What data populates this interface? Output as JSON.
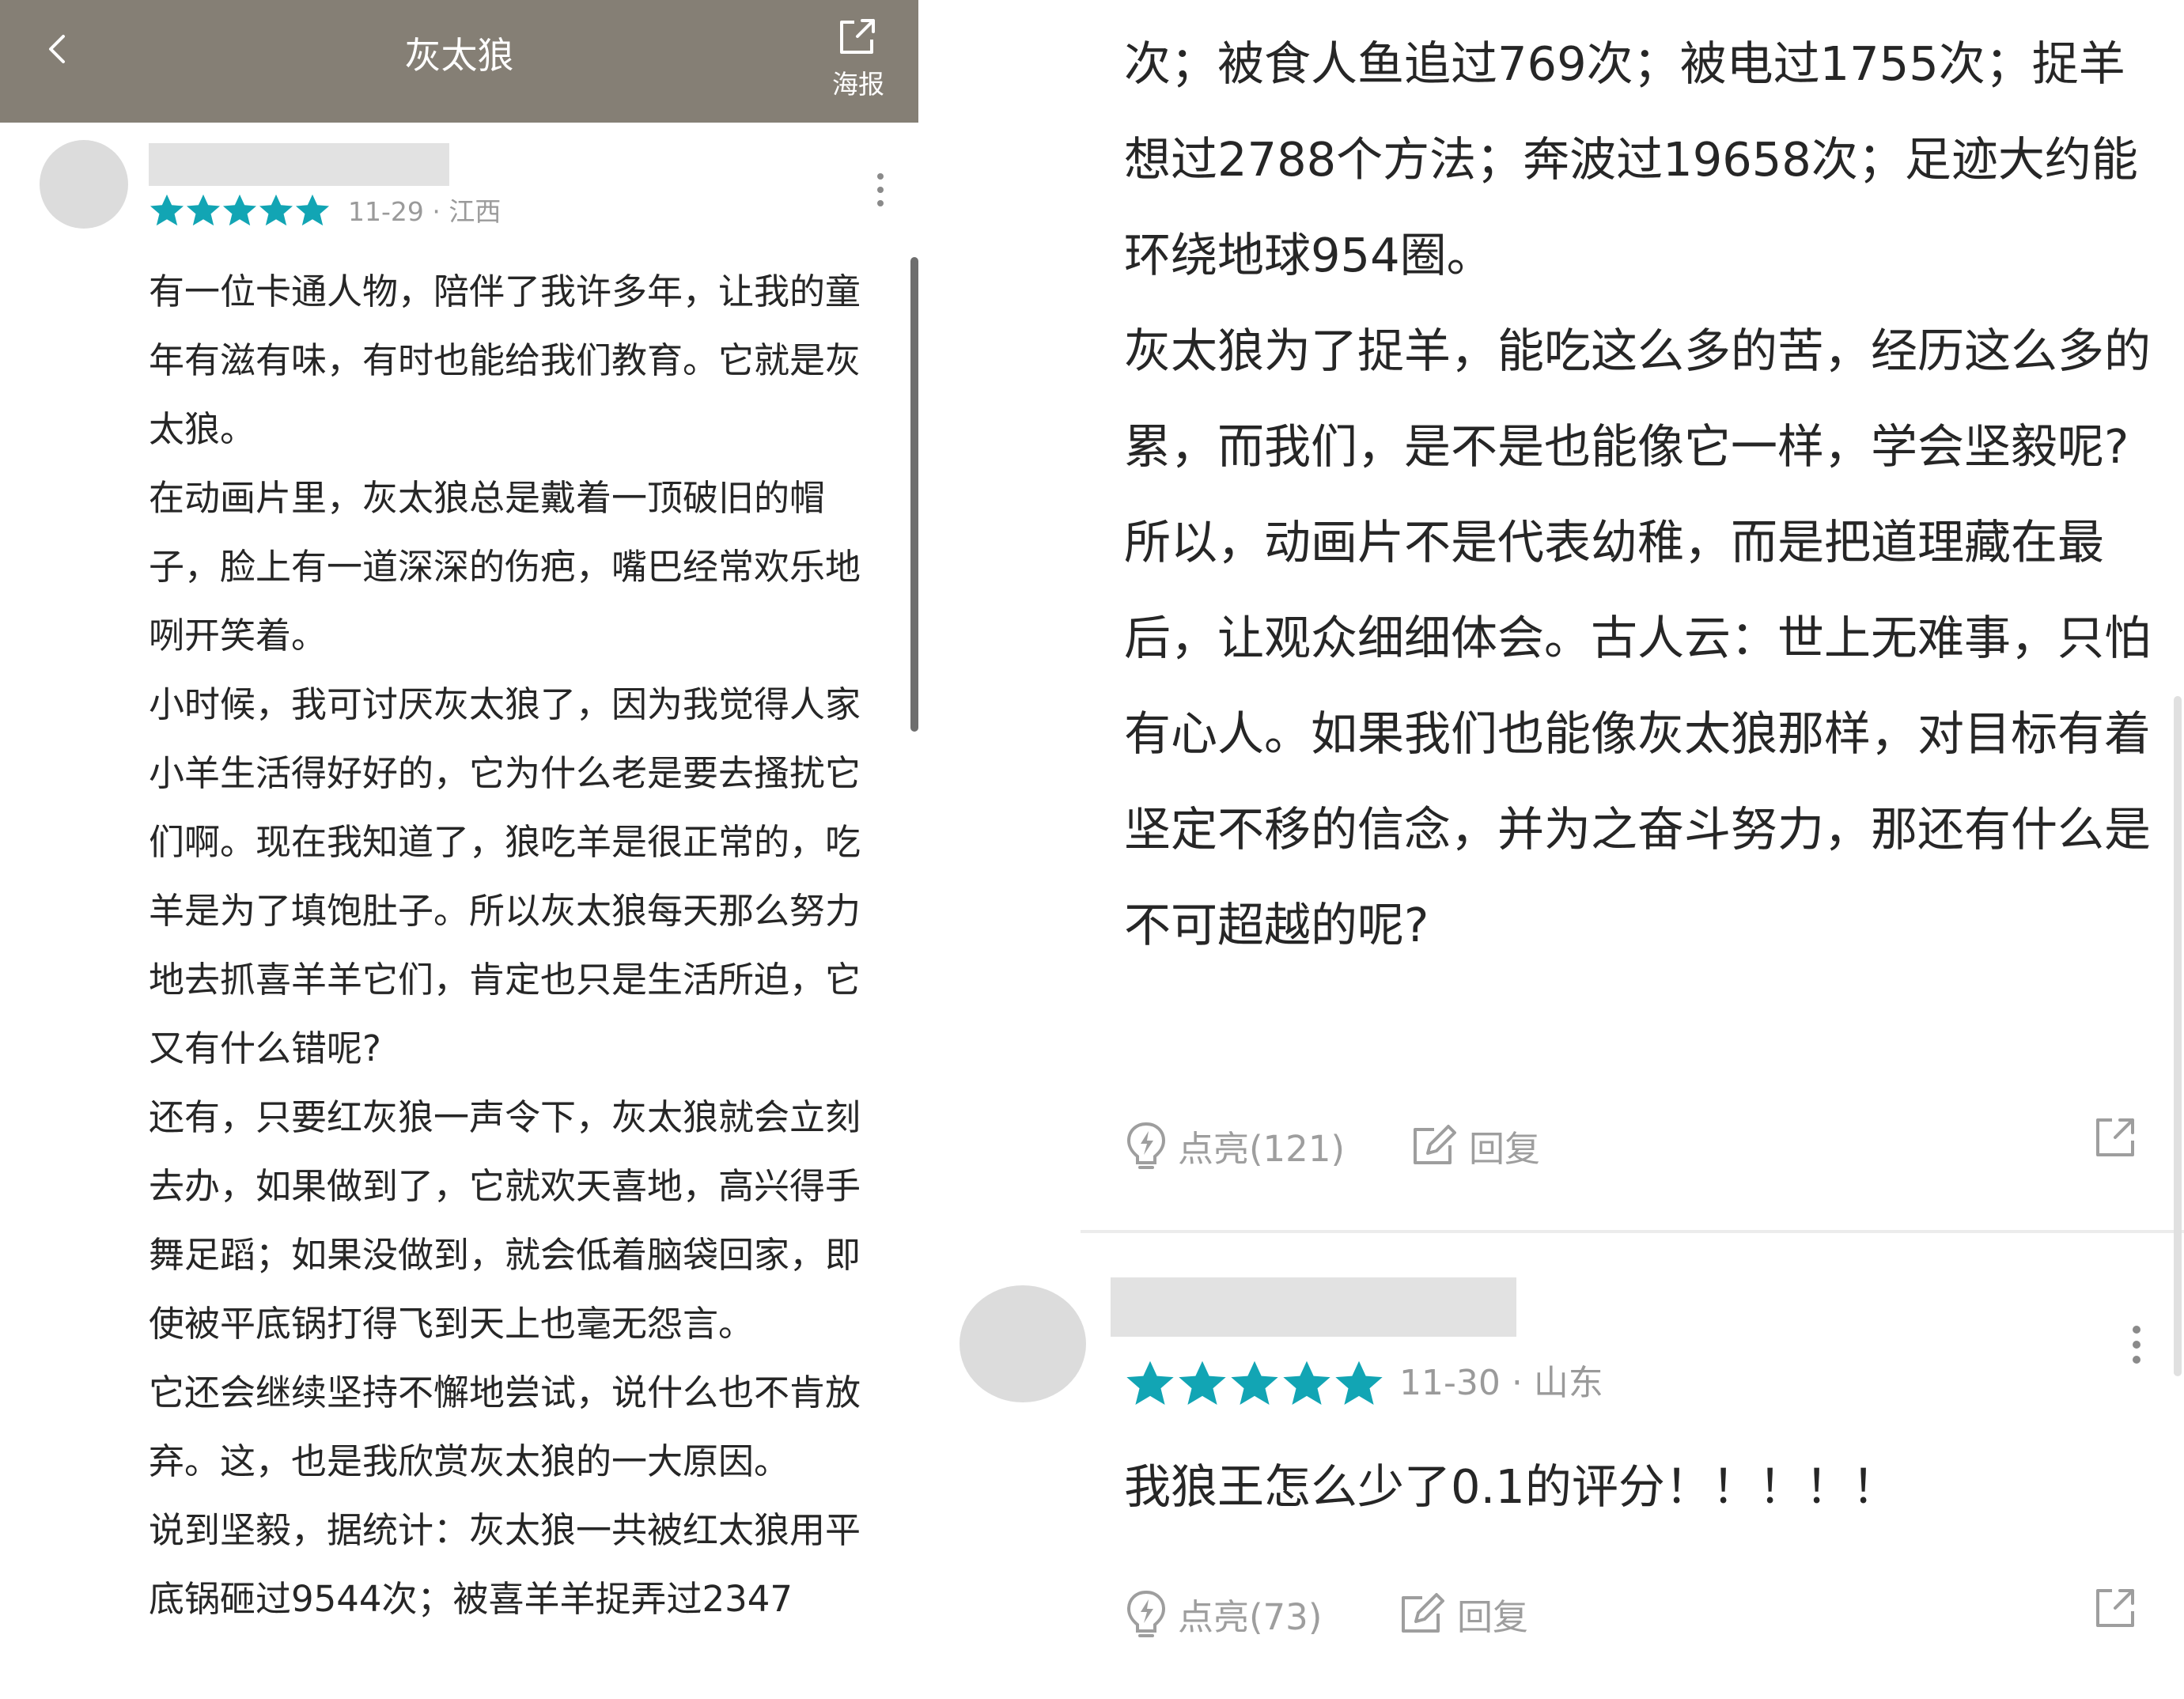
{
  "header": {
    "title": "灰太狼",
    "poster_label": "海报"
  },
  "review1": {
    "meta": "11-29 · 江西",
    "paragraphs": [
      "有一位卡通人物，陪伴了我许多年，让我的童年有滋有味，有时也能给我们教育。它就是灰太狼。",
      "在动画片里，灰太狼总是戴着一顶破旧的帽子，脸上有一道深深的伤疤，嘴巴经常欢乐地咧开笑着。",
      "小时候，我可讨厌灰太狼了，因为我觉得人家小羊生活得好好的，它为什么老是要去搔扰它们啊。现在我知道了，狼吃羊是很正常的，吃羊是为了填饱肚子。所以灰太狼每天那么努力地去抓喜羊羊它们，肯定也只是生活所迫，它又有什么错呢?",
      "还有，只要红灰狼一声令下，灰太狼就会立刻去办，如果做到了，它就欢天喜地，高兴得手舞足蹈；如果没做到，就会低着脑袋回家，即使被平底锅打得飞到天上也毫无怨言。",
      "它还会继续坚持不懈地尝试，说什么也不肯放弃。这，也是我欣赏灰太狼的一大原因。",
      "说到坚毅，据统计：灰太狼一共被红太狼用平底锅砸过9544次；被喜羊羊捉弄过2347"
    ],
    "continued": [
      "次；被食人鱼追过769次；被电过1755次；捉羊想过2788个方法；奔波过19658次；足迹大约能环绕地球954圈。",
      "灰太狼为了捉羊，能吃这么多的苦，经历这么多的累，而我们，是不是也能像它一样，学会坚毅呢?",
      "所以，动画片不是代表幼稚，而是把道理藏在最后，让观众细细体会。古人云：世上无难事，只怕有心人。如果我们也能像灰太狼那样，对目标有着坚定不移的信念，并为之奋斗努力，那还有什么是不可超越的呢?"
    ],
    "like_label": "点亮(121)",
    "reply_label": "回复"
  },
  "review2": {
    "meta": "11-30 · 山东",
    "text": "我狼王怎么少了0.1的评分！！！！！",
    "like_label": "点亮(73)",
    "reply_label": "回复"
  },
  "colors": {
    "header_bg": "#857f75",
    "star": "#12a5b4",
    "muted": "#9e9e9e"
  }
}
